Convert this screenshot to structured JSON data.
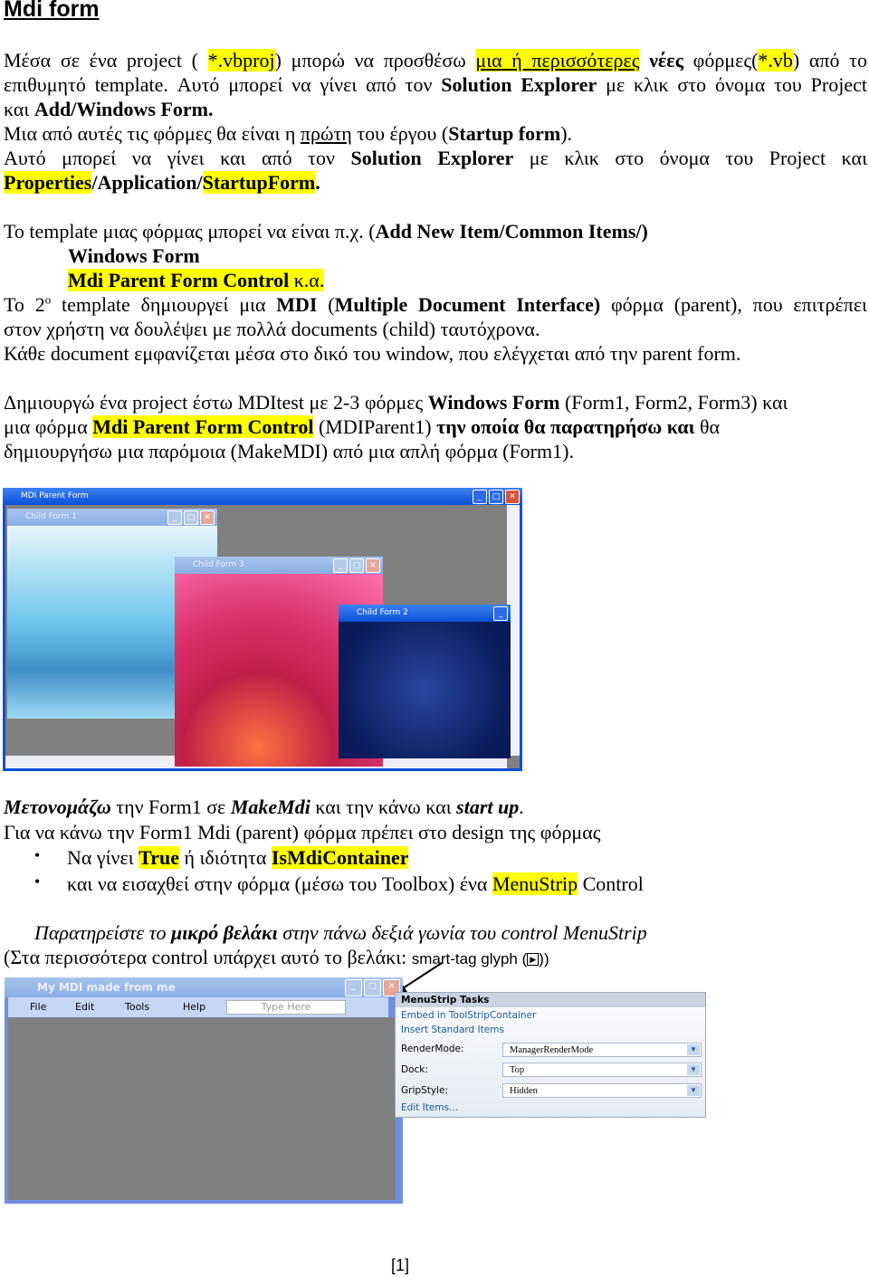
{
  "title": "Mdi form",
  "flow": [
    {
      "j": true,
      "s": [
        {
          "t": "Μέσα σε ένα project ( "
        },
        {
          "t": "*.vbproj",
          "hl": 1
        },
        {
          "t": ") μπορώ να προσθέσω "
        },
        {
          "t": "μια ή περισσότερες",
          "hl": 1,
          "u": 1
        },
        {
          "t": " "
        },
        {
          "t": "νέες",
          "b": 1
        },
        {
          "t": " φόρμες("
        },
        {
          "t": "*.vb",
          "hl": 1
        },
        {
          "t": ") από το"
        }
      ]
    },
    {
      "j": true,
      "s": [
        {
          "t": "επιθυμητό template. Αυτό μπορεί να γίνει από τον "
        },
        {
          "t": "Solution Explorer",
          "b": 1
        },
        {
          "t": " με κλικ στο όνομα του Project"
        }
      ]
    },
    {
      "s": [
        {
          "t": "και "
        },
        {
          "t": "Add/Windows Form.",
          "b": 1
        }
      ]
    },
    {
      "s": [
        {
          "t": "Μια από αυτές τις φόρμες θα είναι η "
        },
        {
          "t": "πρώτη",
          "u": 1
        },
        {
          "t": " του έργου ("
        },
        {
          "t": "Startup form",
          "b": 1
        },
        {
          "t": ")."
        }
      ]
    },
    {
      "j": true,
      "s": [
        {
          "t": "Αυτό μπορεί να γίνει και από τον "
        },
        {
          "t": "Solution Explorer",
          "b": 1
        },
        {
          "t": " με κλικ στο όνομα του Project και"
        }
      ]
    },
    {
      "s": [
        {
          "t": "Properties",
          "b": 1,
          "hl": 1
        },
        {
          "t": "/Application/",
          "b": 1
        },
        {
          "t": "StartupForm",
          "b": 1,
          "hl": 1
        },
        {
          "t": ".",
          "b": 1
        }
      ]
    },
    {
      "s": []
    },
    {
      "s": [
        {
          "t": "Το template μιας φόρμας μπορεί να είναι π.χ. ("
        },
        {
          "t": "Add New Item/Common Items/)",
          "b": 1
        }
      ]
    },
    {
      "ind": true,
      "s": [
        {
          "t": "Windows Form",
          "b": 1
        }
      ]
    },
    {
      "ind": true,
      "s": [
        {
          "t": "Mdi Parent Form Control",
          "b": 1,
          "hl": 1
        },
        {
          "t": " κ.α.",
          "hl": 1
        }
      ]
    },
    {
      "j": true,
      "s": [
        {
          "t": "Το 2"
        },
        {
          "t": "ο",
          "sup": 1
        },
        {
          "t": " template δημιουργεί μια "
        },
        {
          "t": "MDI",
          "b": 1
        },
        {
          "t": " ("
        },
        {
          "t": "Multiple Document Interface)",
          "b": 1
        },
        {
          "t": " φόρμα (parent), που επιτρέπει"
        }
      ]
    },
    {
      "s": [
        {
          "t": "στον χρήστη να δουλέψει με πολλά documents (child) ταυτόχρονα."
        }
      ]
    },
    {
      "s": [
        {
          "t": "Κάθε document εμφανίζεται μέσα στο δικό του window, που ελέγχεται από την parent form."
        }
      ]
    },
    {
      "s": []
    },
    {
      "s": [
        {
          "t": "Δημιουργώ ένα project έστω MDItest με 2-3 φόρμες "
        },
        {
          "t": "Windows Form",
          "b": 1
        },
        {
          "t": " (Form1, Form2, Form3)  και"
        }
      ]
    },
    {
      "s": [
        {
          "t": "μια φόρμα "
        },
        {
          "t": "Mdi Parent Form Control",
          "b": 1,
          "hl": 1
        },
        {
          "t": "  (MDIParent1) "
        },
        {
          "t": "την οποία θα παρατηρήσω και",
          "b": 1
        },
        {
          "t": " θα"
        }
      ]
    },
    {
      "s": [
        {
          "t": "δημιουργήσω  μια παρόμοια (MakeMDI) από μια απλή φόρμα (Form1)."
        }
      ]
    }
  ],
  "screenshot1": {
    "parent_title": "MDI Parent Form",
    "child1_title": "Child Form 1",
    "child3_title": "Child Form 3",
    "child2_title": "Child Form 2"
  },
  "section2": {
    "l1": [
      {
        "t": "Μετονομάζω",
        "b": 1,
        "i": 1
      },
      {
        "t": " την Form1  σε "
      },
      {
        "t": "MakeMdi",
        "b": 1,
        "i": 1
      },
      {
        "t": " και την κάνω και "
      },
      {
        "t": "start up",
        "b": 1,
        "i": 1
      },
      {
        "t": "."
      }
    ],
    "l2": [
      {
        "t": "Για να κάνω την Form1 Mdi (parent) φόρμα πρέπει στο design της φόρμας"
      }
    ],
    "b1": [
      {
        "t": "Να γίνει "
      },
      {
        "t": "True",
        "b": 1,
        "hl": 1
      },
      {
        "t": " ή ιδιότητα "
      },
      {
        "t": "IsMdiContainer",
        "b": 1,
        "hl": 1
      }
    ],
    "b2": [
      {
        "t": "και να εισαχθεί στην φόρμα (μέσω του Toolbox) ένα  "
      },
      {
        "t": "MenuStrip",
        "hl": 1
      },
      {
        "t": " Control"
      }
    ],
    "l3": [
      {
        "t": "Παρατηρείστε το ",
        "i": 1
      },
      {
        "t": "μικρό βελάκι",
        "b": 1,
        "i": 1
      },
      {
        "t": " στην πάνω δεξιά γωνία του control MenuStrip",
        "i": 1
      }
    ],
    "l4_text": "(Στα περισσότερα control υπάρχει αυτό το βελάκι: ",
    "l4_sans": "smart-tag glyph (",
    "l4_end": "))",
    "bullet": "•"
  },
  "screenshot2": {
    "form_title": "My MDI  made from me",
    "menu": [
      "File",
      "Edit",
      "Tools",
      "Help"
    ],
    "type_here": "Type Here",
    "tasks": {
      "header": "MenuStrip Tasks",
      "embed": "Embed in ToolStripContainer",
      "insert": "Insert Standard Items",
      "render_label": "RenderMode:",
      "render_value": "ManagerRenderMode",
      "dock_label": "Dock:",
      "dock_value": "Top",
      "grip_label": "GripStyle:",
      "grip_value": "Hidden",
      "edit": "Edit Items..."
    }
  },
  "page_number": "[1]",
  "colors": {
    "highlight": "#ffff00",
    "xp_blue": "#0a50d8",
    "mdi_gray": "#808080"
  }
}
